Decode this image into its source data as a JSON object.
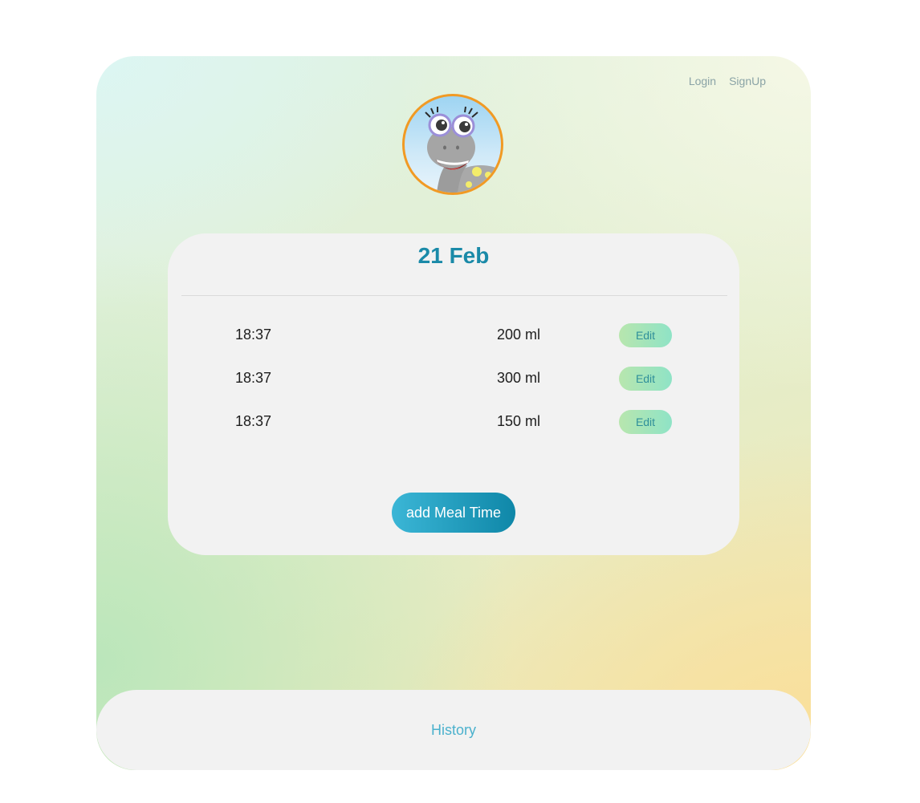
{
  "auth_nav": {
    "login_label": "Login",
    "signup_label": "SignUp"
  },
  "avatar": {
    "icon": "dinosaur-mascot"
  },
  "day_card": {
    "title": "21 Feb",
    "meals": [
      {
        "time": "18:37",
        "amount": "200 ml",
        "edit_label": "Edit"
      },
      {
        "time": "18:37",
        "amount": "300 ml",
        "edit_label": "Edit"
      },
      {
        "time": "18:37",
        "amount": "150 ml",
        "edit_label": "Edit"
      }
    ],
    "add_button_label": "add Meal Time"
  },
  "footer": {
    "history_label": "History"
  },
  "colors": {
    "accent": "#1a8aa8",
    "avatar_border": "#f19a24",
    "card_background": "#f2f2f2",
    "edit_button": "#8fe3c6",
    "link_muted": "#8aa3a6"
  }
}
